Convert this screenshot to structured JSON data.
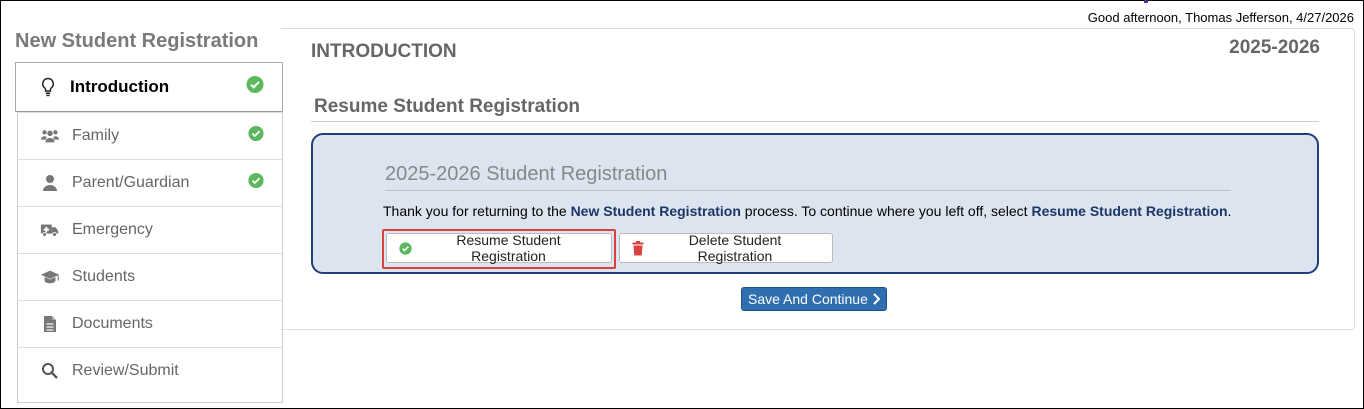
{
  "header": {
    "greeting": "Good afternoon, Thomas Jefferson, 4/27/2026"
  },
  "sidebar": {
    "title": "New Student Registration",
    "items": [
      {
        "label": "Introduction",
        "icon": "lightbulb-icon",
        "completed": true,
        "active": true
      },
      {
        "label": "Family",
        "icon": "users-icon",
        "completed": true
      },
      {
        "label": "Parent/Guardian",
        "icon": "user-icon",
        "completed": true
      },
      {
        "label": "Emergency",
        "icon": "ambulance-icon",
        "completed": false
      },
      {
        "label": "Students",
        "icon": "graduation-cap-icon",
        "completed": false
      },
      {
        "label": "Documents",
        "icon": "document-icon",
        "completed": false
      },
      {
        "label": "Review/Submit",
        "icon": "search-icon",
        "completed": false
      }
    ]
  },
  "main": {
    "title": "INTRODUCTION",
    "year": "2025-2026",
    "subtitle": "Resume Student Registration",
    "panel": {
      "title": "2025-2026 Student Registration",
      "text_1": "Thank you for returning to the ",
      "text_bold_1": "New Student Registration",
      "text_2": " process. To continue where you left off, select ",
      "text_bold_2": "Resume Student Registration",
      "text_3": "."
    },
    "resume_label": "Resume Student Registration",
    "delete_label": "Delete Student Registration",
    "save_label": "Save And Continue"
  },
  "colors": {
    "accent": "#2f6fb0",
    "check": "#5cb85c",
    "delete": "#d9423f",
    "panel_border": "#1f3e7a",
    "panel_bg": "#dce4ef"
  }
}
